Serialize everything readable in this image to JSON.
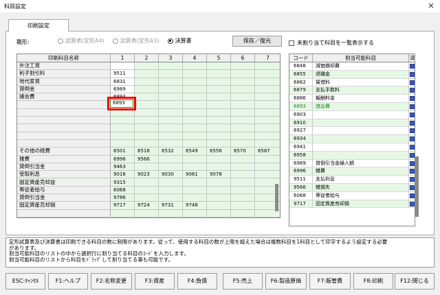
{
  "window": {
    "title": "科目設定",
    "close": "×"
  },
  "tab": {
    "label": "印刷設定"
  },
  "hinagata": {
    "label": "雛形:",
    "options": [
      {
        "label": "試算表(定形A4)",
        "selected": false
      },
      {
        "label": "試算表(定形A3)",
        "selected": false
      },
      {
        "label": "決算書",
        "selected": true
      }
    ]
  },
  "save_button": {
    "label": "保存／復元"
  },
  "checkbox": {
    "label": "未割り当て科目を一覧表示する",
    "checked": false
  },
  "grid": {
    "headers": [
      "印刷科目名称",
      "1",
      "2",
      "3",
      "4",
      "5",
      "6",
      "7"
    ],
    "rows": [
      {
        "name": "外注工賃",
        "cells": [
          "",
          "",
          "",
          "",
          "",
          "",
          ""
        ]
      },
      {
        "name": "利子割引料",
        "cells": [
          "9511",
          "",
          "",
          "",
          "",
          "",
          ""
        ]
      },
      {
        "name": "地代家賃",
        "cells": [
          "6831",
          "",
          "",
          "",
          "",
          "",
          ""
        ]
      },
      {
        "name": "貸倒金",
        "cells": [
          "6989",
          "",
          "",
          "",
          "",
          "",
          ""
        ]
      },
      {
        "name": "諸会費",
        "cells": [
          "6893",
          "",
          "",
          "",
          "",
          "",
          ""
        ]
      },
      {
        "name": "",
        "cells": [
          "",
          "",
          "",
          "",
          "",
          "",
          ""
        ]
      },
      {
        "name": "",
        "cells": [
          "",
          "",
          "",
          "",
          "",
          "",
          ""
        ]
      },
      {
        "name": "",
        "cells": [
          "",
          "",
          "",
          "",
          "",
          "",
          ""
        ]
      },
      {
        "name": "",
        "cells": [
          "",
          "",
          "",
          "",
          "",
          "",
          ""
        ]
      },
      {
        "name": "",
        "cells": [
          "",
          "",
          "",
          "",
          "",
          "",
          ""
        ]
      },
      {
        "name": "",
        "cells": [
          "",
          "",
          "",
          "",
          "",
          "",
          ""
        ]
      },
      {
        "name": "その他の経費",
        "cells": [
          "6501",
          "6518",
          "6532",
          "6549",
          "6556",
          "6570",
          "6587"
        ]
      },
      {
        "name": "雑費",
        "cells": [
          "6996",
          "9566",
          "",
          "",
          "",
          "",
          ""
        ]
      },
      {
        "name": "貸倒引当金",
        "cells": [
          "9463",
          "",
          "",
          "",
          "",
          "",
          ""
        ]
      },
      {
        "name": "受取利息",
        "cells": [
          "9016",
          "9023",
          "9030",
          "9061",
          "9078",
          "",
          ""
        ]
      },
      {
        "name": "固定資産売却益",
        "cells": [
          "9315",
          "",
          "",
          "",
          "",
          "",
          ""
        ]
      },
      {
        "name": "専従者給与",
        "cells": [
          "6068",
          "",
          "",
          "",
          "",
          "",
          ""
        ]
      },
      {
        "name": "貸倒引当金",
        "cells": [
          "9786",
          "",
          "",
          "",
          "",
          "",
          ""
        ]
      },
      {
        "name": "固定資産売却損",
        "cells": [
          "9717",
          "9724",
          "9731",
          "9748",
          "",
          "",
          ""
        ]
      },
      {
        "name": "",
        "cells": [
          "",
          "",
          "",
          "",
          "",
          "",
          ""
        ]
      }
    ]
  },
  "selected_cell_value": "6893",
  "list": {
    "headers": [
      "コード",
      "割当可能科目",
      "済"
    ],
    "rows": [
      {
        "code": "6848",
        "name": "減価償却費",
        "done": true
      },
      {
        "code": "6855",
        "name": "退職金",
        "done": true
      },
      {
        "code": "6862",
        "name": "賃借料",
        "done": true
      },
      {
        "code": "6879",
        "name": "支払手数料",
        "done": true
      },
      {
        "code": "6886",
        "name": "報酬料金",
        "done": true
      },
      {
        "code": "6893",
        "name": "諸会費",
        "done": true
      },
      {
        "code": "6903",
        "name": "",
        "done": true
      },
      {
        "code": "6910",
        "name": "",
        "done": true
      },
      {
        "code": "6927",
        "name": "",
        "done": true
      },
      {
        "code": "6934",
        "name": "",
        "done": true
      },
      {
        "code": "6941",
        "name": "",
        "done": true
      },
      {
        "code": "6958",
        "name": "",
        "done": true
      },
      {
        "code": "6989",
        "name": "貸倒引当金繰入額",
        "done": true
      },
      {
        "code": "6996",
        "name": "雑費",
        "done": true
      },
      {
        "code": "9511",
        "name": "支払利息",
        "done": true
      },
      {
        "code": "9566",
        "name": "雑損失",
        "done": true
      },
      {
        "code": "6068",
        "name": "専従者給与",
        "done": true
      },
      {
        "code": "9717",
        "name": "固定資産売却損",
        "done": true
      }
    ]
  },
  "message": {
    "lines": [
      "定形試算表及び決算書は印刷できる科目の数に制限があります。従って、使用する科目の数が上限を超えた場合は複数科目を1科目として印字するよう設定する必要",
      "があります。",
      "割当可能科目のリストの中から選択行に割り当てる科目のｺｰﾄﾞを入力します。",
      "割当可能科目のリストから科目をﾄﾞﾗｯｸﾞして割り当てる事も可能です。"
    ]
  },
  "fkeys": [
    "ESC:ｷｬﾝｾﾙ",
    "F1:ヘルプ",
    "F2:名称変更",
    "F3:資産",
    "F4:負債",
    "F5:売上",
    "F6:製造原価",
    "F7:販管費",
    "F8:印刷",
    "F12:閉じる"
  ]
}
